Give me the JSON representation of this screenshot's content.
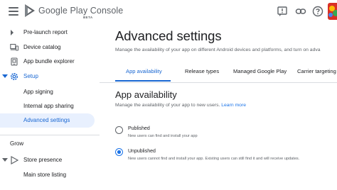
{
  "header": {
    "brand": "Google Play Console",
    "badge": "BETA",
    "icons": [
      "menu-icon",
      "google-play-logo-icon",
      "feedback-icon",
      "link-icon",
      "help-icon",
      "avatar"
    ],
    "colors": {
      "accent": "#1a73e8",
      "active_bg": "#e8f0fe"
    }
  },
  "sidebar": {
    "items": [
      {
        "label": "Pre-launch report",
        "icon": "caret-icon"
      },
      {
        "label": "Device catalog",
        "icon": "devices-icon"
      },
      {
        "label": "App bundle explorer",
        "icon": "bundle-icon"
      },
      {
        "label": "Setup",
        "icon": "gear-icon"
      },
      {
        "label": "App signing"
      },
      {
        "label": "Internal app sharing"
      },
      {
        "label": "Advanced settings"
      },
      {
        "label": "Store presence",
        "icon": "play-icon"
      },
      {
        "label": "Main store listing"
      }
    ],
    "section_grow": "Grow"
  },
  "main": {
    "title": "Advanced settings",
    "description": "Manage the availability of your app on different Android devices and platforms, and turn on adva",
    "tabs": [
      {
        "label": "App availability",
        "active": true
      },
      {
        "label": "Release types"
      },
      {
        "label": "Managed Google Play"
      },
      {
        "label": "Carrier targeting"
      }
    ],
    "section_title": "App availability",
    "section_desc": "Manage the availability of your app to new users.",
    "learn_more": "Learn more",
    "options": [
      {
        "label": "Published",
        "sub": "New users can find and install your app",
        "checked": false
      },
      {
        "label": "Unpublished",
        "sub": "New users cannot find and install your app. Existing users can still find it and will receive updates.",
        "checked": true
      }
    ]
  }
}
